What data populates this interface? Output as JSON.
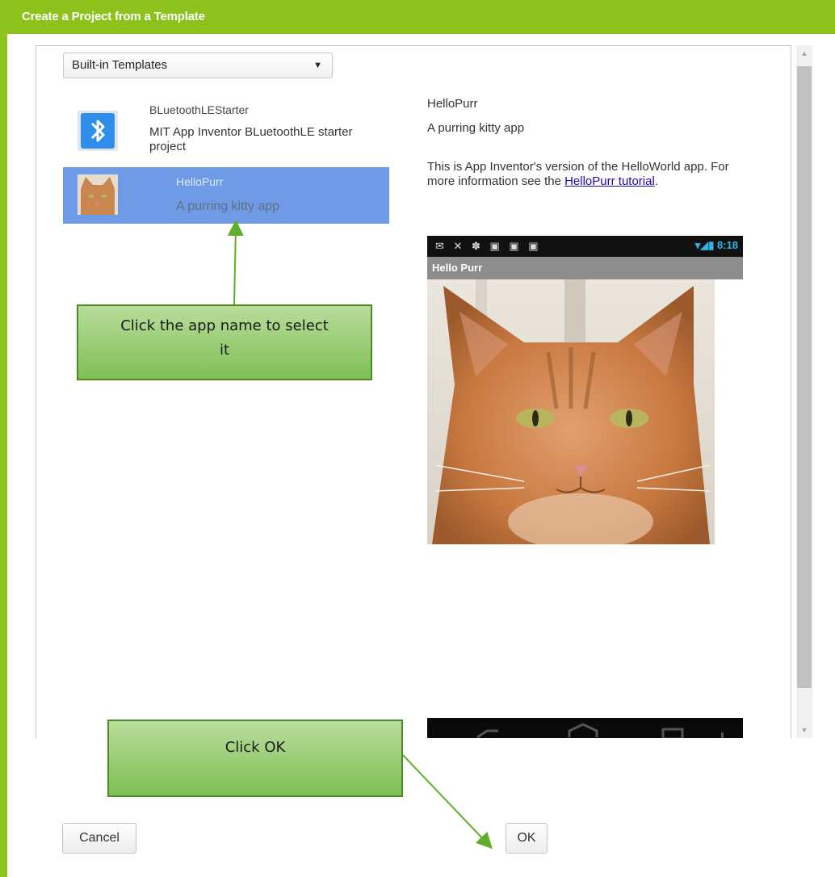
{
  "dialog": {
    "title": "Create a Project from a Template",
    "accent_color": "#8cc21b"
  },
  "template_source": {
    "selected": "Built-in Templates",
    "arrow_glyph": "▼"
  },
  "templates": [
    {
      "name": "BLuetoothLEStarter",
      "description": "MIT App Inventor BLuetoothLE starter project",
      "icon": "bluetooth-icon",
      "selected": false
    },
    {
      "name": "HelloPurr",
      "description": "A purring kitty app",
      "icon": "cat-thumbnail",
      "selected": true
    }
  ],
  "preview": {
    "title": "HelloPurr",
    "subtitle": "A purring kitty app",
    "description_text": "This is App Inventor's version of the HelloWorld app. For more information see the ",
    "link_text": "HelloPurr tutorial",
    "trailing": ".",
    "phone": {
      "status_icons": "✉ ✕ ✽ ▣ ▣ ▣",
      "time": "▾◢▮ 8:18",
      "app_title": "Hello Purr"
    }
  },
  "annotations": {
    "select_hint": "Click the app name to select it",
    "ok_hint": "Click OK",
    "color": "#7fc055"
  },
  "buttons": {
    "cancel_label": "Cancel",
    "ok_label": "OK"
  },
  "scrollbar": {
    "up_glyph": "▲",
    "down_glyph": "▼"
  }
}
